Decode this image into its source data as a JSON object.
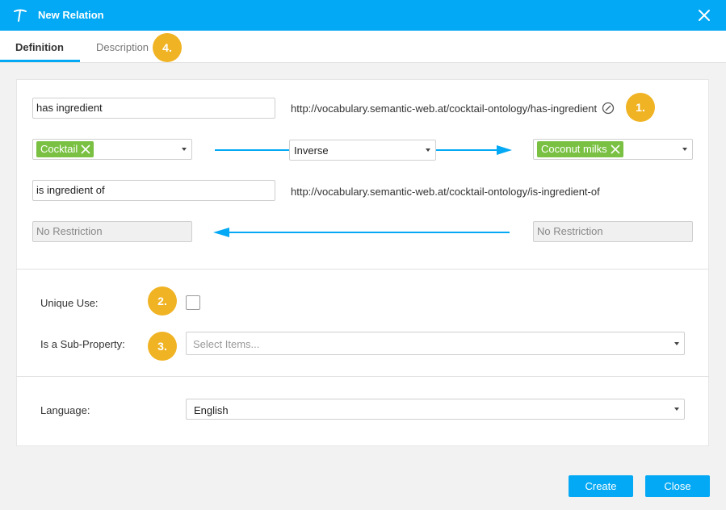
{
  "window": {
    "title": "New Relation"
  },
  "tabs": [
    {
      "label": "Definition",
      "active": true
    },
    {
      "label": "Description",
      "active": false
    }
  ],
  "badges": {
    "uri": "1.",
    "unique": "2.",
    "subprop": "3.",
    "description": "4."
  },
  "relation": {
    "name": "has ingredient",
    "uri": "http://vocabulary.semantic-web.at/cocktail-ontology/has-ingredient",
    "source_class": "Cocktail",
    "direction": "Inverse",
    "target_class": "Coconut milks",
    "inverse_name": "is ingredient of",
    "inverse_uri": "http://vocabulary.semantic-web.at/cocktail-ontology/is-ingredient-of",
    "source_restriction": "No Restriction",
    "target_restriction": "No Restriction"
  },
  "options": {
    "unique_use_label": "Unique Use:",
    "unique_use_checked": false,
    "sub_property_label": "Is a Sub-Property:",
    "sub_property_placeholder": "Select Items...",
    "language_label": "Language:",
    "language_value": "English"
  },
  "buttons": {
    "create": "Create",
    "close": "Close"
  },
  "colors": {
    "accent": "#03a9f4",
    "tag": "#7ac143",
    "badge": "#f0b323"
  }
}
